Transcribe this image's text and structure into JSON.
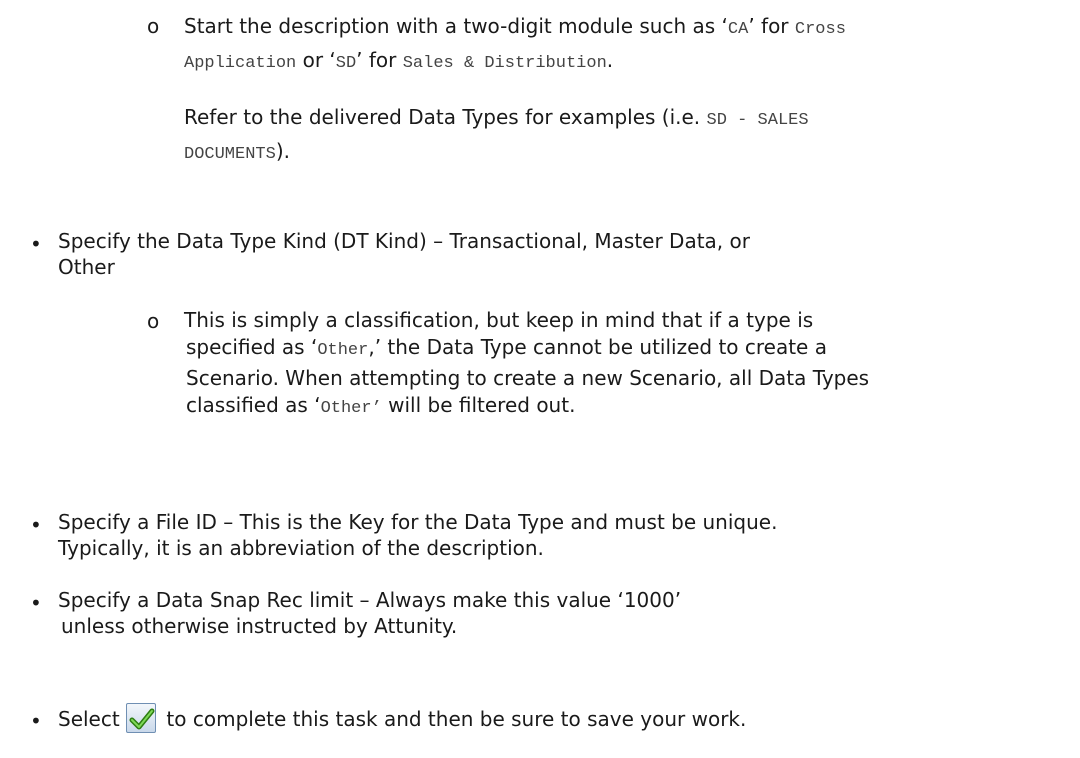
{
  "section1": {
    "marker": "o",
    "p1_a": "Start the description with a two-digit module such as ‘",
    "p1_code1": "CA",
    "p1_b": "’ for ",
    "p1_code2": "Cross",
    "p1_code2b": "Application",
    "p1_c": " or ‘",
    "p1_code3": "SD",
    "p1_d": "’ for ",
    "p1_code4": "Sales & Distribution",
    "p1_e": ".",
    "p2_a": "Refer to the delivered Data Types for examples (i.e. ",
    "p2_code": "SD - SALES",
    "p2_code2": "DOCUMENTS",
    "p2_b": ")."
  },
  "bullet_char": "•",
  "dt_kind": {
    "line1": "Specify the  Data  Type  Kind  (DT Kind) – Transactional, Master Data, or",
    "line2": "Other",
    "sub_marker": "o",
    "sub_l1": "This is simply a classification, but keep in mind that if a type is",
    "sub_l2_a": "specified as ‘",
    "sub_l2_code": "Other",
    "sub_l2_b": ",’ the Data Type cannot be utilized to create a",
    "sub_l3": "Scenario. When attempting to create a new Scenario, all Data Types",
    "sub_l4_a": "classified as ‘",
    "sub_l4_code": "Other’",
    "sub_l4_b": " will be filtered out."
  },
  "file_id": {
    "line1": "Specify a File  ID – This is the Key for the Data Type and must be unique.",
    "line2": "Typically, it is an abbreviation of the description."
  },
  "snap": {
    "line1": "Specify a Data Snap Rec limit – Always make this value ‘1000’",
    "line2": "unless otherwise instructed by Attunity."
  },
  "select": {
    "a": "Select ",
    "icon": "green-checkmark-icon",
    "b": " to complete this task and then be sure to save your work."
  },
  "colors": {
    "check_green": "#3e9a1e",
    "text": "#1a1a1a"
  }
}
